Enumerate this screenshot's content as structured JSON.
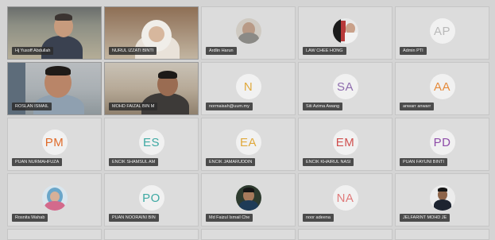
{
  "participants": [
    {
      "name": "Hj Yusoff Abdullah",
      "type": "video",
      "cam": "cam-0"
    },
    {
      "name": "NURUL IZZATI BINTI",
      "type": "video",
      "cam": "cam-1"
    },
    {
      "name": "Ardlin Harun",
      "type": "photo",
      "photo": "ph-ardlin"
    },
    {
      "name": "LAW CHEE HONG",
      "type": "photo",
      "photo": "ph-law"
    },
    {
      "name": "Admin PTI",
      "type": "initials",
      "initials": "AP",
      "color": "#b9b9b9"
    },
    {
      "name": "ROSLAN ISMAIL",
      "type": "video",
      "cam": "cam-5"
    },
    {
      "name": "MOHD FAIZAL BIN M",
      "type": "video",
      "cam": "cam-6"
    },
    {
      "name": "normaisah@uum.my",
      "type": "initials",
      "initials": "N",
      "color": "#e0a93c"
    },
    {
      "name": "Siti Azima Awang",
      "type": "initials",
      "initials": "SA",
      "color": "#8e6cae"
    },
    {
      "name": "anwarr anwarr",
      "type": "initials",
      "initials": "AA",
      "color": "#e58a3a"
    },
    {
      "name": "PUAN NURMAHFUZA",
      "type": "initials",
      "initials": "PM",
      "color": "#e06b2a"
    },
    {
      "name": "ENCIK SHAMSUL AM",
      "type": "initials",
      "initials": "ES",
      "color": "#3ea9a3"
    },
    {
      "name": "ENCIK JAMARUDDIN",
      "type": "initials",
      "initials": "EA",
      "color": "#e0a93c"
    },
    {
      "name": "ENCIK KHAIRUL NASI",
      "type": "initials",
      "initials": "EM",
      "color": "#d0504f"
    },
    {
      "name": "PUAN FAYUNI BINTI",
      "type": "initials",
      "initials": "PD",
      "color": "#8e4ca8"
    },
    {
      "name": "Rosnita Wahab",
      "type": "photo",
      "photo": "ph-rosnita"
    },
    {
      "name": "PUAN NOORAINI BIN",
      "type": "initials",
      "initials": "PO",
      "color": "#3ea9a3"
    },
    {
      "name": "Md Faizul Ismail Che",
      "type": "photo",
      "photo": "ph-faizul"
    },
    {
      "name": "noor adeena",
      "type": "initials",
      "initials": "NA",
      "color": "#e07b7b"
    },
    {
      "name": "JELFARINT MOHD JE",
      "type": "photo",
      "photo": "ph-jelfa"
    }
  ]
}
